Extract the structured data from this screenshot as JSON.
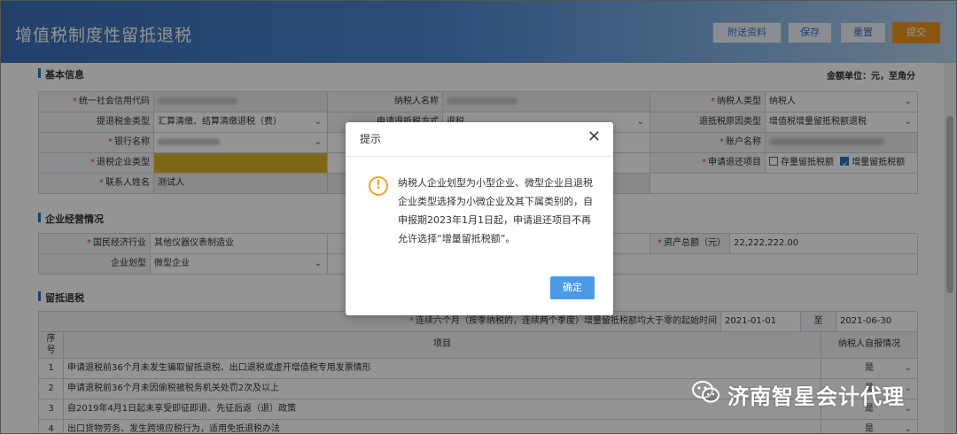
{
  "header": {
    "title": "增值税制度性留抵退税",
    "buttons": {
      "attach": "附送资料",
      "save": "保存",
      "reset": "重置",
      "submit": "提交"
    }
  },
  "basic_info": {
    "section_title": "基本信息",
    "unit_text": "金额单位：元，至角分",
    "credit_code_label": "统一社会信用代码",
    "taxpayer_name_label": "纳税人名称",
    "taxpayer_type_label": "纳税人类型",
    "taxpayer_type_value": "纳税人",
    "refund_type_label": "提退税金类型",
    "refund_type_value": "汇算清缴、结算清缴退税（费）",
    "refund_method_label": "申请退抵税方式",
    "refund_method_value": "退税",
    "refund_reason_label": "退抵税原因类型",
    "refund_reason_value": "增值税增量留抵税额退税",
    "bank_label": "银行名称",
    "account_name_label": "账户名称",
    "enterprise_type_label": "退税企业类型",
    "apply_item_label": "申请退还项目",
    "option_stock": "存量留抵税额",
    "option_incremental": "增量留抵税额",
    "contact_label": "联系人姓名",
    "contact_value": "测试人"
  },
  "operation": {
    "section_title": "企业经营情况",
    "industry_label": "国民经济行业",
    "industry_value": "其他仪器仪表制造业",
    "assets_label": "资产总额（元）",
    "assets_value": "22,222,222.00",
    "scale_label": "企业划型",
    "scale_value": "微型企业"
  },
  "retained": {
    "section_title": "留抵退税",
    "period_label": "连续六个月（按季纳税的，连续两个季度）增量留抵税额均大于零的起始时间",
    "period_start": "2021-01-01",
    "period_to": "至",
    "period_end": "2021-06-30",
    "col_seq": "序号",
    "col_item": "项目",
    "col_self": "纳税人自报情况",
    "rows": [
      {
        "no": "1",
        "item": "申请退税前36个月未发生骗取留抵退税、出口退税或虚开增值税专用发票情形",
        "value": "是"
      },
      {
        "no": "2",
        "item": "申请退税前36个月未因偷税被税务机关处罚2次及以上",
        "value": "是"
      },
      {
        "no": "3",
        "item": "自2019年4月1日起未享受即征即退、先征后返（退）政策",
        "value": "是"
      },
      {
        "no": "4",
        "item": "出口货物劳务、发生跨境应税行为，适用免抵退税办法",
        "value": "是"
      }
    ]
  },
  "dialog": {
    "title": "提示",
    "message": "纳税人企业划型为小型企业、微型企业且退税企业类型选择为小微企业及其下属类别的，自申报期2023年1月1日起，申请退还项目不再允许选择“增量留抵税额”。",
    "ok_label": "确定"
  },
  "watermark": {
    "text": "济南智星会计代理"
  },
  "colors": {
    "accent": "#2f6fbf",
    "submit": "#f0961a",
    "highlight": "#dcb228",
    "dialog_button": "#4b9ae6"
  }
}
